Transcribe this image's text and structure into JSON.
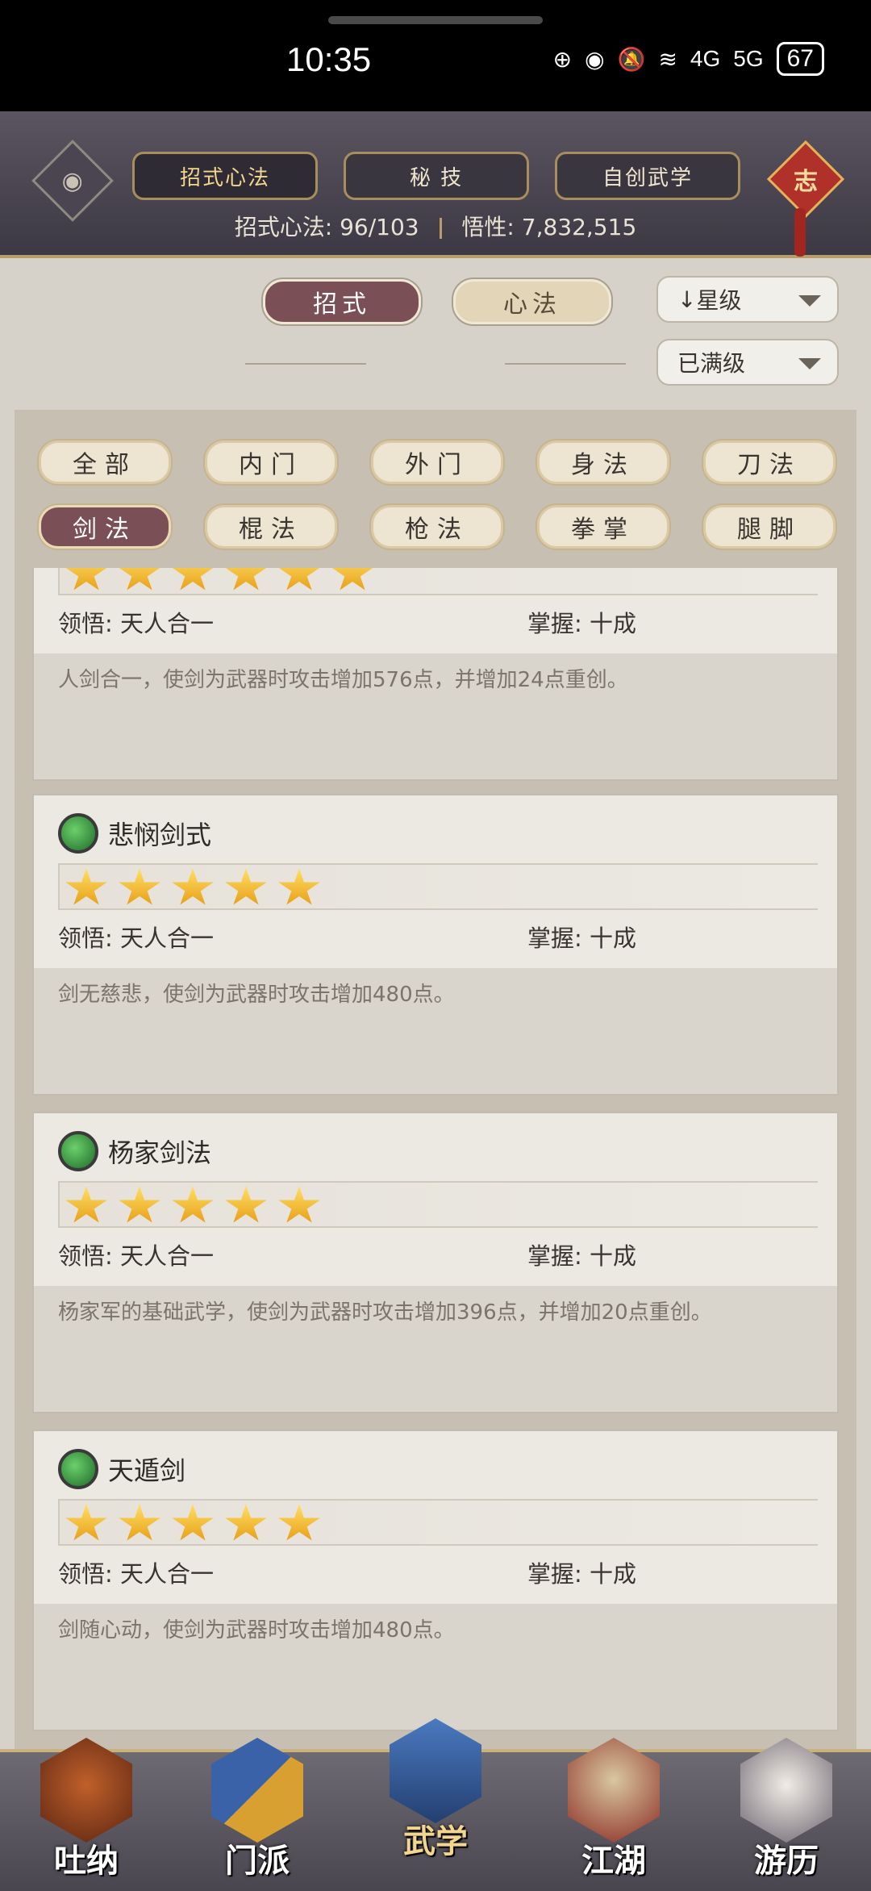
{
  "status_bar": {
    "time": "10:35",
    "icons": [
      "hd-icon",
      "eye-icon",
      "mute-icon",
      "wifi-icon"
    ],
    "signal_4g": "4G",
    "signal_5g": "5G",
    "battery": "67"
  },
  "header": {
    "tabs": [
      "招式心法",
      "秘 技",
      "自创武学"
    ],
    "active_tab": 0,
    "knot_char": "志",
    "stats_left_label": "招式心法:",
    "stats_left_value": "96/103",
    "stats_right_label": "悟性:",
    "stats_right_value": "7,832,515"
  },
  "controls": {
    "toggle": [
      "招式",
      "心法"
    ],
    "toggle_active": 0,
    "sort_label": "星级",
    "filter_label": "已满级"
  },
  "categories": {
    "row1": [
      "全部",
      "内门",
      "外门",
      "身法",
      "刀法"
    ],
    "row2": [
      "剑法",
      "棍法",
      "枪法",
      "拳掌",
      "腿脚"
    ],
    "active": "剑法"
  },
  "skills": [
    {
      "name": "",
      "stars": 5,
      "comprehension_label": "领悟:",
      "comprehension": "天人合一",
      "mastery_label": "掌握:",
      "mastery": "十成",
      "desc": "人剑合一，使剑为武器时攻击增加576点，并增加24点重创。"
    },
    {
      "name": "悲悯剑式",
      "stars": 5,
      "comprehension_label": "领悟:",
      "comprehension": "天人合一",
      "mastery_label": "掌握:",
      "mastery": "十成",
      "desc": "剑无慈悲，使剑为武器时攻击增加480点。"
    },
    {
      "name": "杨家剑法",
      "stars": 5,
      "comprehension_label": "领悟:",
      "comprehension": "天人合一",
      "mastery_label": "掌握:",
      "mastery": "十成",
      "desc": "杨家军的基础武学，使剑为武器时攻击增加396点，并增加20点重创。"
    },
    {
      "name": "天遁剑",
      "stars": 5,
      "comprehension_label": "领悟:",
      "comprehension": "天人合一",
      "mastery_label": "掌握:",
      "mastery": "十成",
      "desc": "剑随心动，使剑为武器时攻击增加480点。"
    }
  ],
  "bottom_nav": {
    "items": [
      "吐纳",
      "门派",
      "武学",
      "江湖",
      "游历"
    ],
    "active": 2,
    "colors": [
      "#8a3b1f",
      "#3a62a8",
      "#2c4f8a",
      "#8a2a22",
      "#6a6470"
    ]
  }
}
